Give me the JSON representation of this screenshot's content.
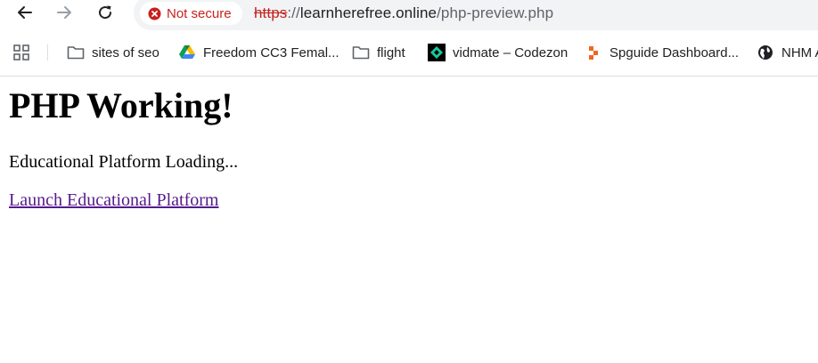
{
  "browser": {
    "nav": {
      "back_icon": "arrow-left-icon",
      "forward_icon": "arrow-right-icon",
      "reload_icon": "reload-icon"
    },
    "omnibox": {
      "security_label": "Not secure",
      "security_icon": "warning-circle-icon",
      "url_scheme": "https",
      "url_separator": "://",
      "url_host": "learnherefree.online",
      "url_path": "/php-preview.php",
      "security_color": "#c5221f"
    },
    "bookmarks": [
      {
        "label": "sites of seo",
        "icon": "folder-icon"
      },
      {
        "label": "Freedom CC3 Femal...",
        "icon": "google-drive-icon"
      },
      {
        "label": "flight",
        "icon": "folder-icon"
      },
      {
        "label": "vidmate – Codezon",
        "icon": "codezon-icon"
      },
      {
        "label": "Spguide Dashboard...",
        "icon": "spguide-icon"
      },
      {
        "label": "NHM A",
        "icon": "globe-icon"
      }
    ],
    "apps_icon": "apps-grid-icon"
  },
  "page": {
    "heading": "PHP Working!",
    "status_text": "Educational Platform Loading...",
    "link_text": "Launch Educational Platform",
    "link_color": "#551a8b"
  }
}
